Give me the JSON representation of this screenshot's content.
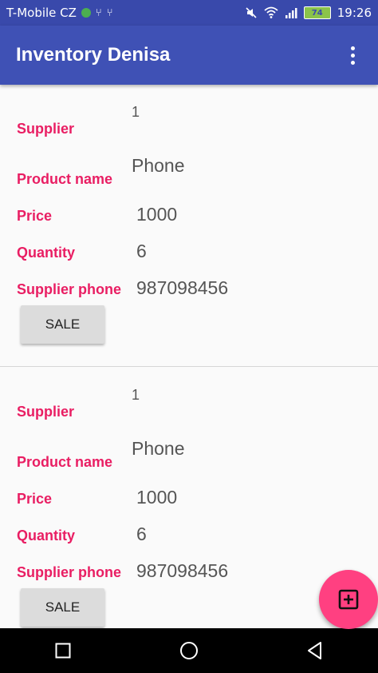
{
  "status_bar": {
    "carrier": "T-Mobile CZ",
    "battery": "74",
    "time": "19:26"
  },
  "app_bar": {
    "title": "Inventory Denisa"
  },
  "labels": {
    "supplier": "Supplier",
    "product_name": "Product name",
    "price": "Price",
    "quantity": "Quantity",
    "supplier_phone": "Supplier phone"
  },
  "items": [
    {
      "supplier": "1",
      "product_name": "Phone",
      "price": "1000",
      "quantity": "6",
      "supplier_phone": "987098456",
      "sale_label": "SALE"
    },
    {
      "supplier": "1",
      "product_name": "Phone",
      "price": "1000",
      "quantity": "6",
      "supplier_phone": "987098456",
      "sale_label": "SALE"
    }
  ],
  "colors": {
    "primary": "#3f51b5",
    "primary_dark": "#3949ab",
    "accent": "#ff4081",
    "label": "#e91e63"
  }
}
